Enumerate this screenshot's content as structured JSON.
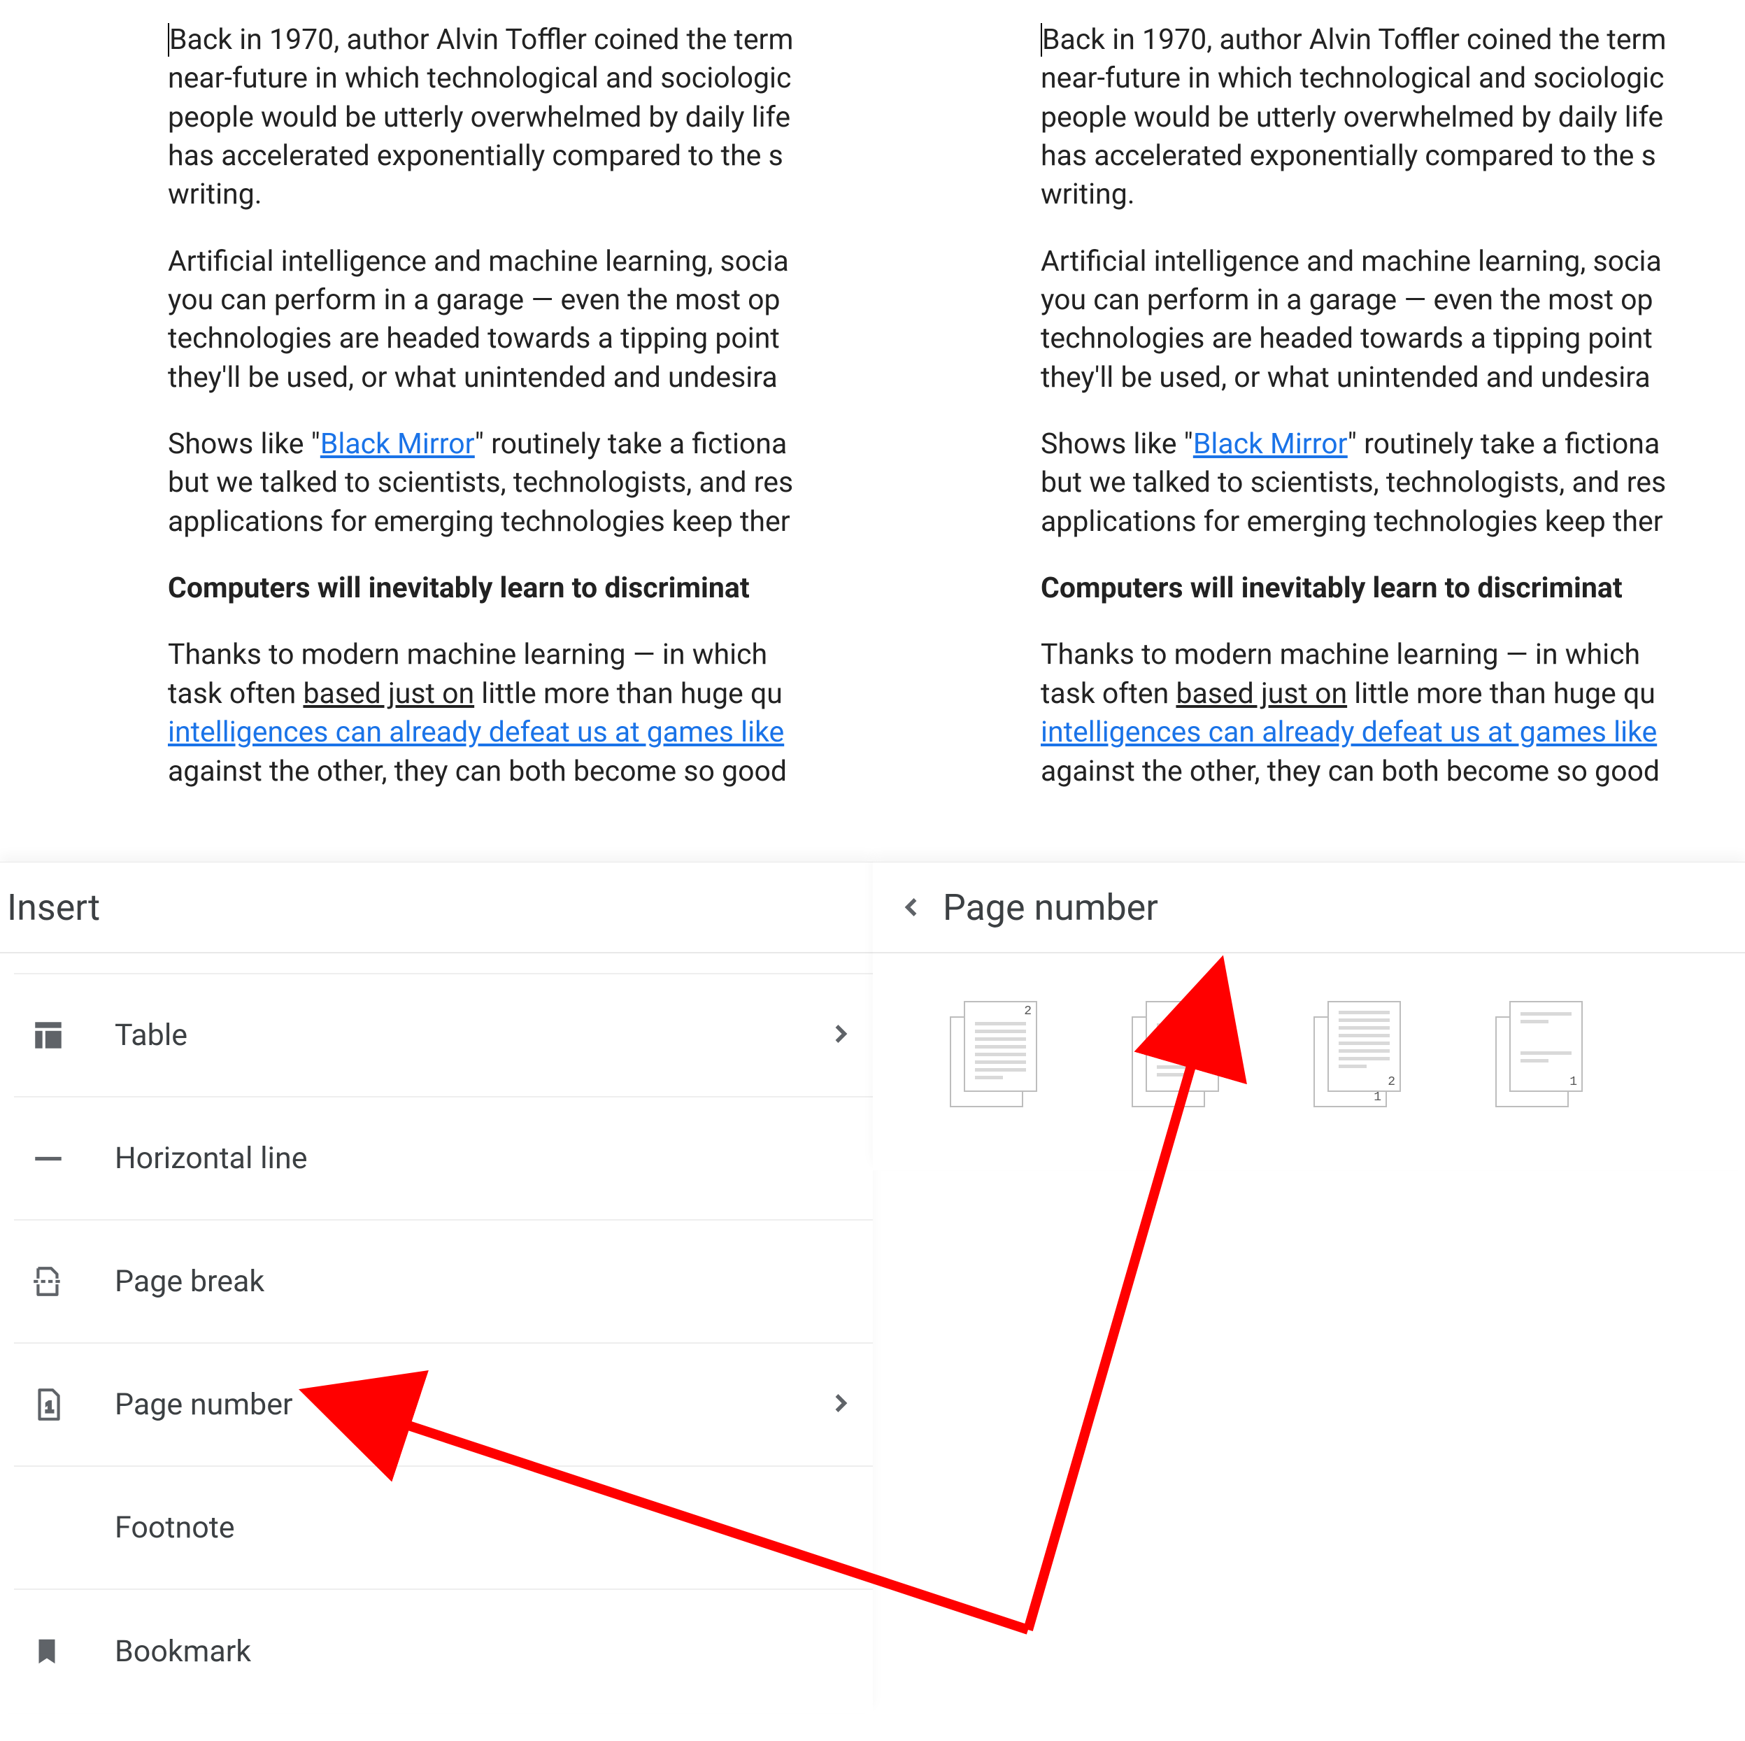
{
  "doc": {
    "p1_a": "Back in 1970, author Alvin Toffler coined the term",
    "p1_b": "near-future in which technological and sociologic",
    "p1_c": "people would be utterly overwhelmed by daily life",
    "p1_d": "has accelerated exponentially compared to the s",
    "p1_e": "writing.",
    "p2_a": "Artificial intelligence and machine learning, socia",
    "p2_b": "you can perform in a garage — even the most op",
    "p2_c": "technologies are headed towards a tipping point",
    "p2_d": "they'll be used, or what unintended and undesira",
    "p3_a": "Shows like \"",
    "p3_link": "Black Mirror",
    "p3_b": "\" routinely take a fictiona",
    "p3_c": "but we talked to scientists, technologists, and res",
    "p3_d": "applications for emerging technologies keep ther",
    "p4": "Computers will inevitably learn to discriminat",
    "p5_a": "Thanks to modern machine learning — in which",
    "p5_b_pre": "task often ",
    "p5_b_u": "based just on",
    "p5_b_post": " little more than huge qu",
    "p5_link": "intelligences can already defeat us at games like",
    "p5_c": "against the other, they can both become so good"
  },
  "left_menu": {
    "title": "Insert",
    "items": {
      "table": "Table",
      "hr": "Horizontal line",
      "pagebreak": "Page break",
      "pagenumber": "Page number",
      "footnote": "Footnote",
      "bookmark": "Bookmark"
    }
  },
  "right_menu": {
    "title": "Page number",
    "options": [
      "header-numbered",
      "header-plain",
      "footer-numbered",
      "footer-plain"
    ]
  }
}
